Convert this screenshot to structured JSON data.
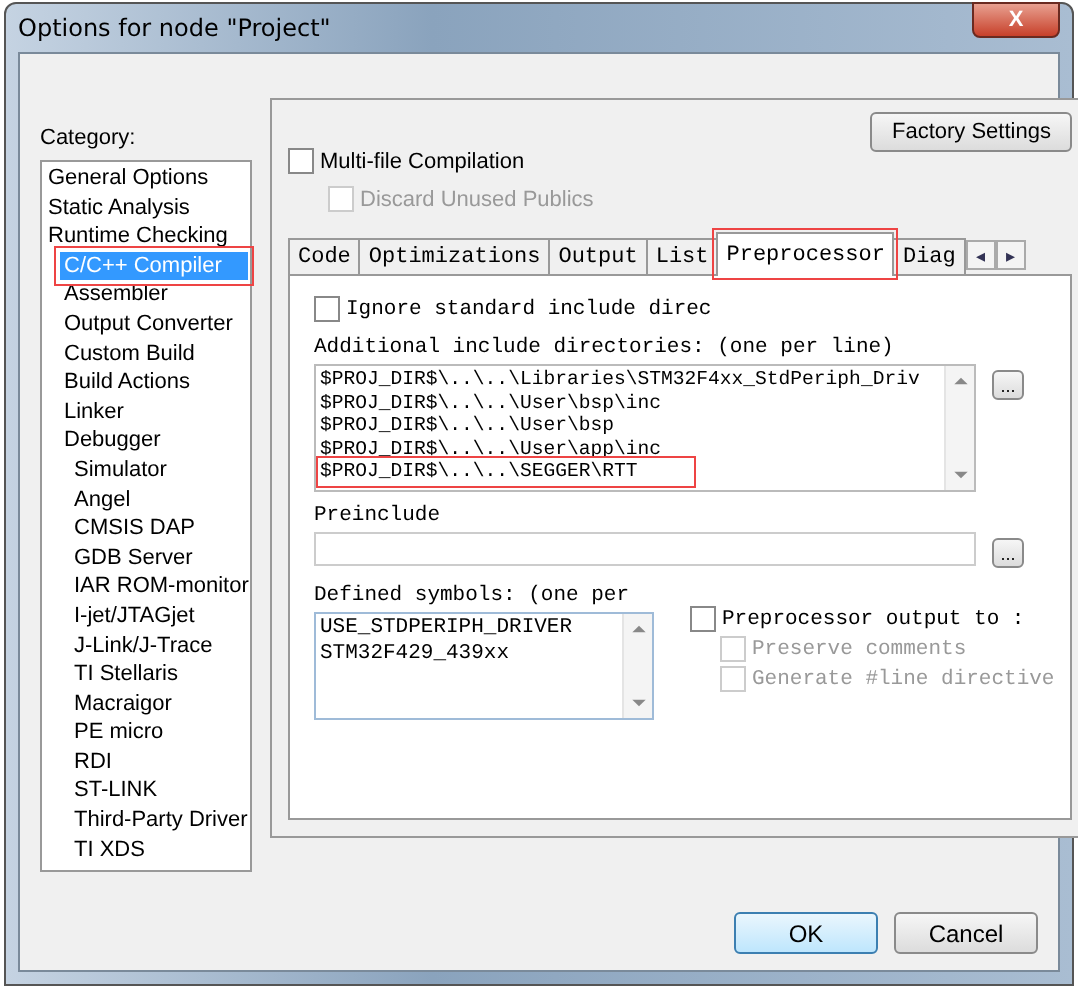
{
  "window": {
    "title": "Options for node \"Project\"",
    "close_symbol": "X"
  },
  "category": {
    "label": "Category:",
    "items": [
      {
        "label": "General Options",
        "selected": false,
        "highlighted": false
      },
      {
        "label": "Static Analysis",
        "selected": false,
        "highlighted": false
      },
      {
        "label": "Runtime Checking",
        "selected": false,
        "highlighted": false
      },
      {
        "label": "C/C++ Compiler",
        "selected": true,
        "highlighted": true
      },
      {
        "label": "Assembler",
        "selected": false,
        "highlighted": false
      },
      {
        "label": "Output Converter",
        "selected": false,
        "highlighted": false
      },
      {
        "label": "Custom Build",
        "selected": false,
        "highlighted": false
      },
      {
        "label": "Build Actions",
        "selected": false,
        "highlighted": false
      },
      {
        "label": "Linker",
        "selected": false,
        "highlighted": false
      },
      {
        "label": "Debugger",
        "selected": false,
        "highlighted": false,
        "children": [
          {
            "label": "Simulator",
            "selected": false,
            "highlighted": false
          },
          {
            "label": "Angel",
            "selected": false,
            "highlighted": false
          },
          {
            "label": "CMSIS DAP",
            "selected": false,
            "highlighted": false
          },
          {
            "label": "GDB Server",
            "selected": false,
            "highlighted": false
          },
          {
            "label": "IAR ROM-monitor",
            "selected": false,
            "highlighted": false
          },
          {
            "label": "I-jet/JTAGjet",
            "selected": false,
            "highlighted": false
          },
          {
            "label": "J-Link/J-Trace",
            "selected": false,
            "highlighted": false
          },
          {
            "label": "TI Stellaris",
            "selected": false,
            "highlighted": false
          },
          {
            "label": "Macraigor",
            "selected": false,
            "highlighted": false
          },
          {
            "label": "PE micro",
            "selected": false,
            "highlighted": false
          },
          {
            "label": "RDI",
            "selected": false,
            "highlighted": false
          },
          {
            "label": "ST-LINK",
            "selected": false,
            "highlighted": false
          },
          {
            "label": "Third-Party Driver",
            "selected": false,
            "highlighted": false
          },
          {
            "label": "TI XDS",
            "selected": false,
            "highlighted": false
          }
        ]
      }
    ]
  },
  "factory_settings": "Factory Settings",
  "multi_file": {
    "label": "Multi-file Compilation",
    "checked": false,
    "disabled": false
  },
  "discard_unused": {
    "label": "Discard Unused Publics",
    "checked": false,
    "disabled": true
  },
  "tabs": [
    {
      "label": "Code",
      "selected": false,
      "highlighted": false
    },
    {
      "label": "Optimizations",
      "selected": false,
      "highlighted": false
    },
    {
      "label": "Output",
      "selected": false,
      "highlighted": false
    },
    {
      "label": "List",
      "selected": false,
      "highlighted": false
    },
    {
      "label": "Preprocessor",
      "selected": true,
      "highlighted": true
    },
    {
      "label": "Diag",
      "selected": false,
      "highlighted": false
    }
  ],
  "tab_scroll": {
    "left": "◂",
    "right": "▸"
  },
  "ignore_standard": {
    "label": "Ignore standard include direc",
    "checked": false,
    "disabled": false
  },
  "include_dirs": {
    "label": "Additional include directories: (one per line)",
    "browse": "...",
    "lines": [
      {
        "text": "$PROJ_DIR$\\..\\..\\Libraries\\STM32F4xx_StdPeriph_Driv",
        "highlighted": false
      },
      {
        "text": "$PROJ_DIR$\\..\\..\\User\\bsp\\inc",
        "highlighted": false
      },
      {
        "text": "$PROJ_DIR$\\..\\..\\User\\bsp",
        "highlighted": false
      },
      {
        "text": "$PROJ_DIR$\\..\\..\\User\\app\\inc",
        "highlighted": false
      },
      {
        "text": "$PROJ_DIR$\\..\\..\\SEGGER\\RTT",
        "highlighted": true
      }
    ]
  },
  "preinclude": {
    "label": "Preinclude",
    "browse": "..."
  },
  "defined_symbols": {
    "label": "Defined symbols: (one per",
    "lines": [
      "USE_STDPERIPH_DRIVER",
      "STM32F429_439xx"
    ]
  },
  "preprocessor_output": {
    "label": "Preprocessor output to :",
    "checked": false,
    "disabled": false
  },
  "preserve_comments": {
    "label": "Preserve comments",
    "checked": false,
    "disabled": true
  },
  "generate_line": {
    "label": "Generate #line directive",
    "checked": false,
    "disabled": true
  },
  "buttons": [
    {
      "label": "OK",
      "selected": true
    },
    {
      "label": "Cancel",
      "selected": false
    }
  ]
}
